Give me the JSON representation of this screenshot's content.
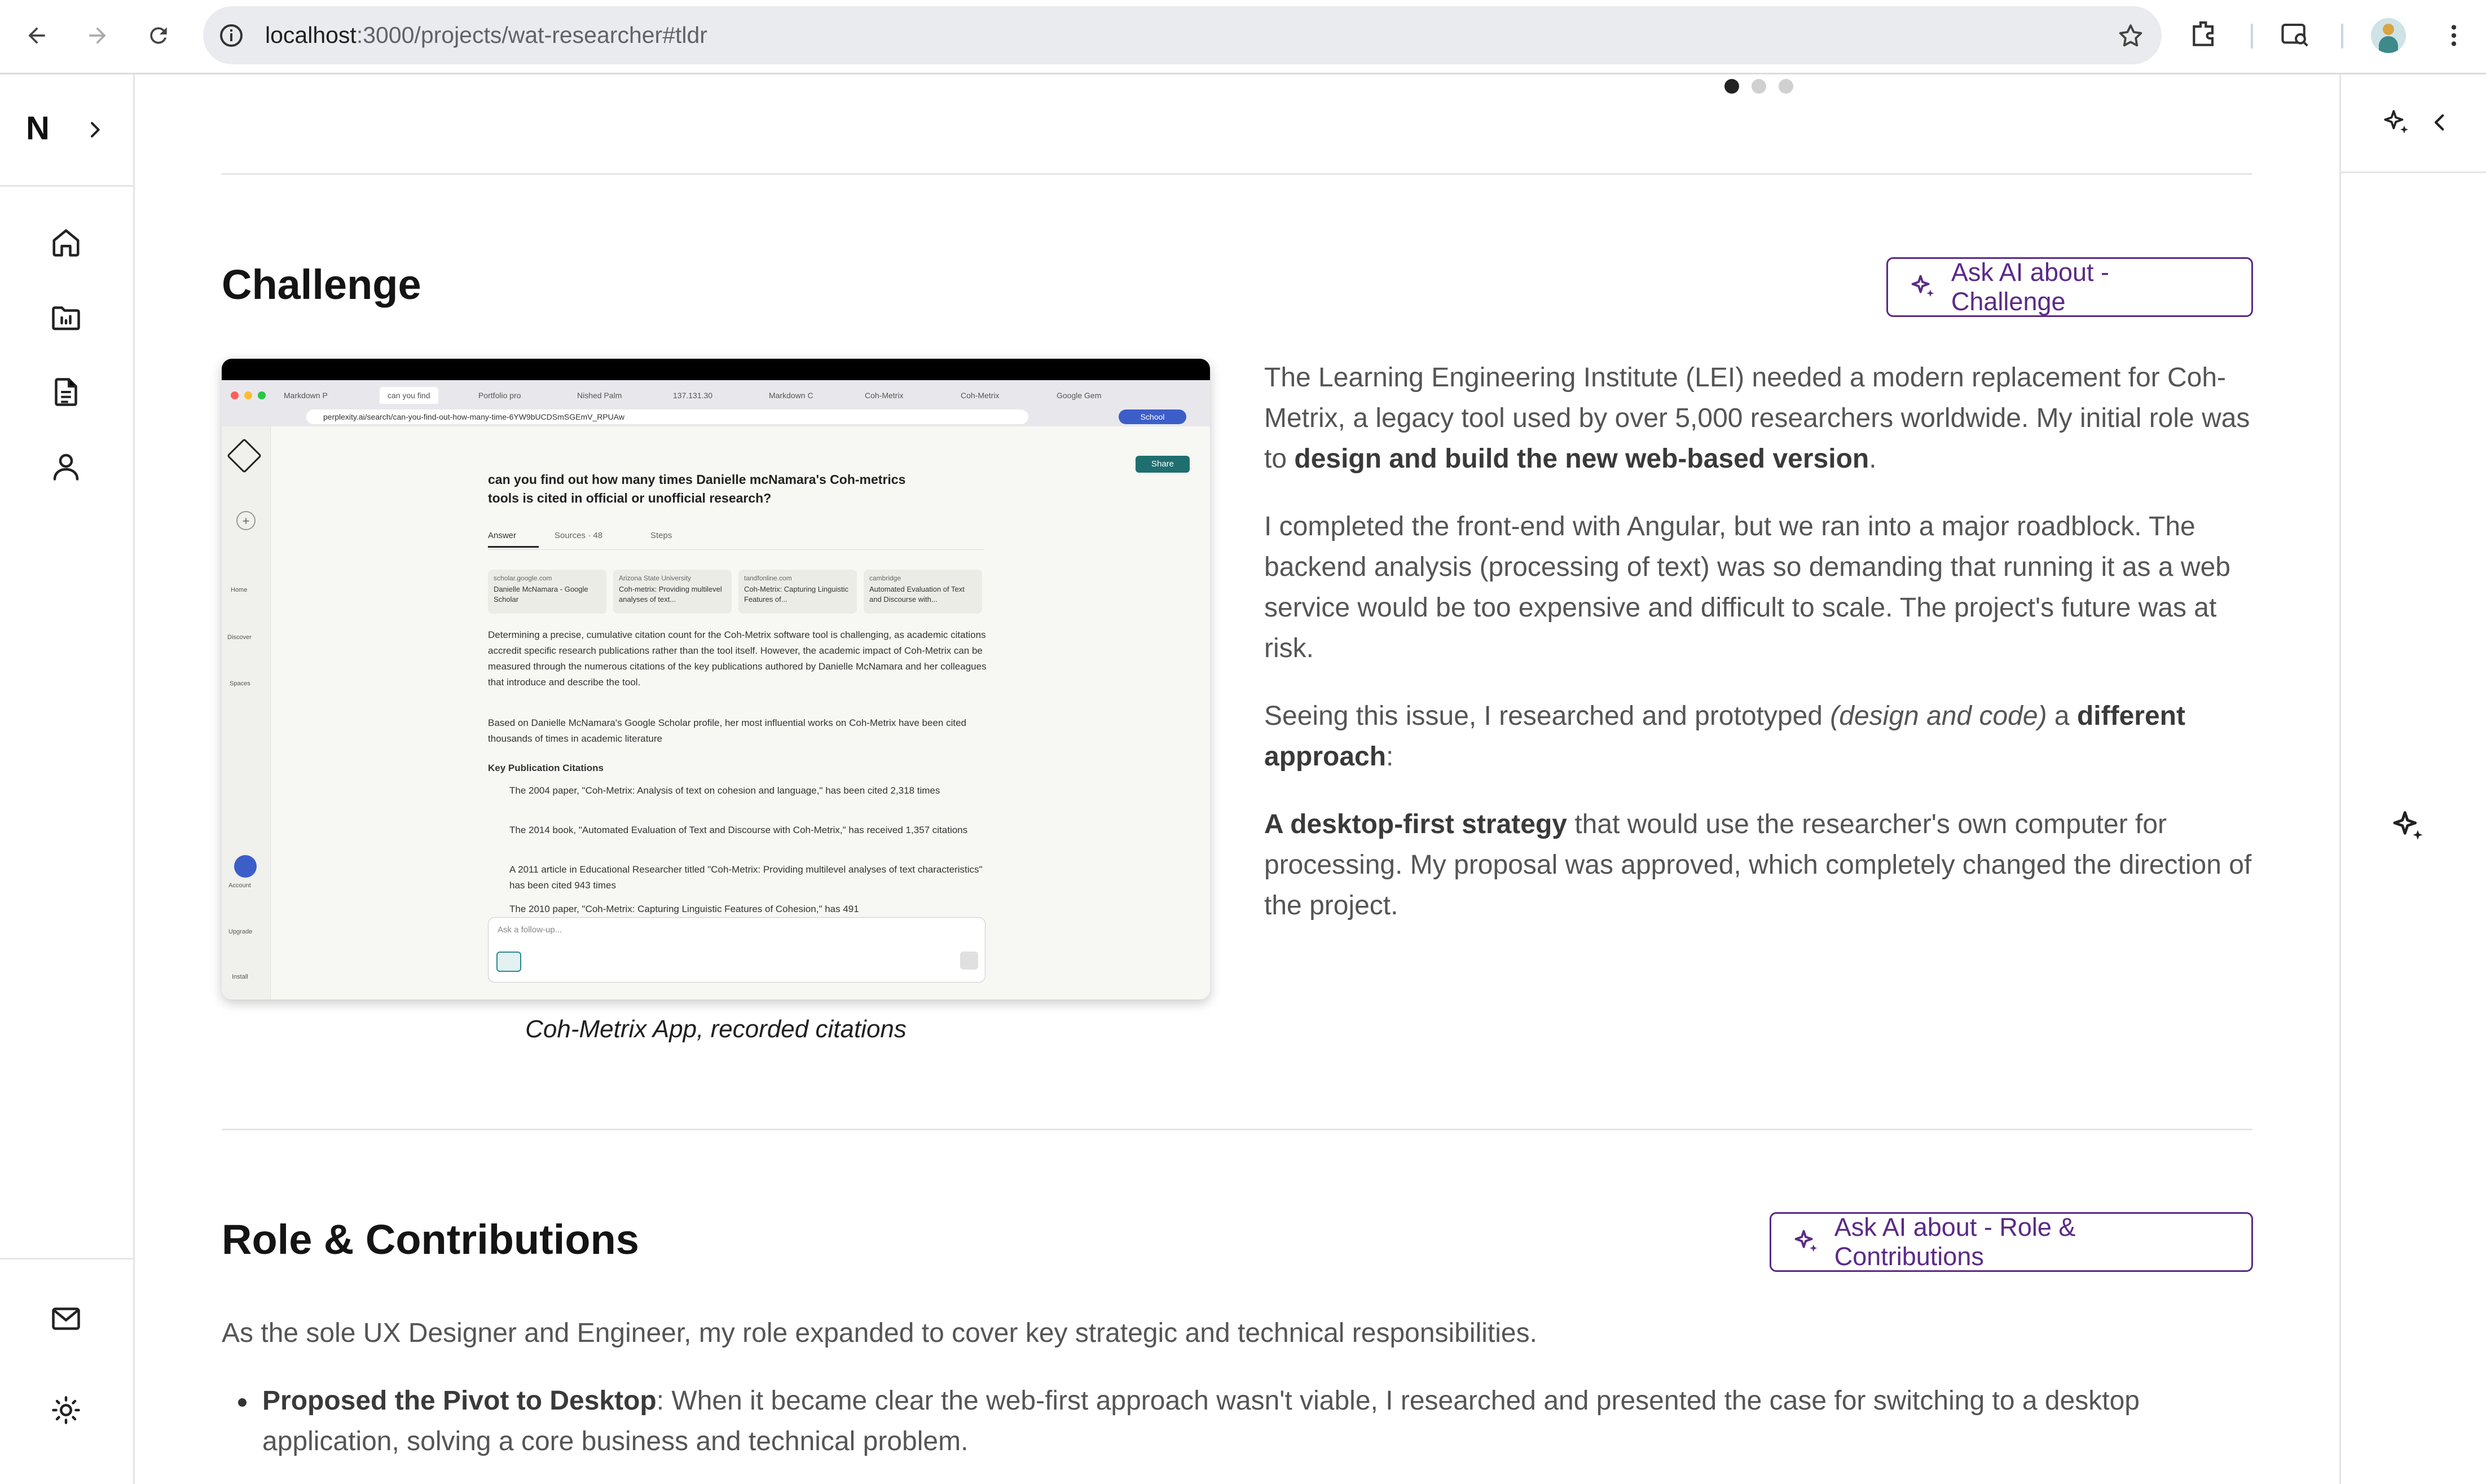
{
  "browser": {
    "url_host": "localhost",
    "url_path": ":3000/projects/wat-researcher#tldr",
    "back_icon": "arrow-left-icon",
    "forward_icon": "arrow-right-icon",
    "reload_icon": "reload-icon"
  },
  "sidebar": {
    "logo": "N",
    "expand_icon": "chevron-right-icon",
    "items": [
      {
        "icon": "home-icon",
        "label": "Home"
      },
      {
        "icon": "projects-icon",
        "label": "Projects"
      },
      {
        "icon": "document-icon",
        "label": "Resume"
      },
      {
        "icon": "user-icon",
        "label": "About"
      }
    ],
    "bottom": [
      {
        "icon": "mail-icon"
      },
      {
        "icon": "sun-icon"
      }
    ]
  },
  "carousel": {
    "dots": 3,
    "active": 0
  },
  "challenge": {
    "title": "Challenge",
    "ask_ai_label": "Ask AI about - Challenge",
    "image_caption": "Coh-Metrix App, recorded citations",
    "paragraphs": {
      "p1a": "The Learning Engineering Institute (LEI) needed a modern replacement for Coh-Metrix, a legacy tool used by over 5,000 researchers worldwide. My initial role was to ",
      "p1b": "design and build the new web-based version",
      "p1c": ".",
      "p2": "I completed the front-end with Angular, but we ran into a major roadblock. The backend analysis (processing of text) was so demanding that running it as a web service would be too expensive and difficult to scale. The project's future was at risk.",
      "p3a": "Seeing this issue, I researched and prototyped ",
      "p3b": "(design and code)",
      "p3c": " a ",
      "p3d": "different approach",
      "p3e": ":",
      "p4a": "A desktop-first strategy",
      "p4b": " that would use the researcher's own computer for processing. My proposal was approved, which completely changed the direction of the project."
    }
  },
  "embedded": {
    "tabs": [
      "Markdown P",
      "can you find",
      "Portfolio pro",
      "Nished Palm",
      "137.131.30",
      "Markdown C",
      "Coh-Metrix",
      "Coh-Metrix",
      "Google Gem"
    ],
    "url": "perplexity.ai/search/can-you-find-out-how-many-time-6YW9bUCDSmSGEmV_RPUAw",
    "school": "School",
    "question": "can you find out how many times Danielle mcNamara's Coh-metrics tools is cited in official or unofficial research?",
    "share": "Share",
    "answer_tab": "Answer",
    "sources_tab": "Sources · 48",
    "steps_tab": "Steps",
    "sources": [
      {
        "site": "scholar.google.com",
        "title": "Danielle McNamara - Google Scholar"
      },
      {
        "site": "Arizona State University",
        "title": "Coh-metrix: Providing multilevel analyses of text..."
      },
      {
        "site": "tandfonline.com",
        "title": "Coh-Metrix: Capturing Linguistic Features of..."
      },
      {
        "site": "cambridge",
        "title": "Automated Evaluation of Text and Discourse with..."
      }
    ],
    "answer_p1": "Determining a precise, cumulative citation count for the Coh-Metrix software tool is challenging, as academic citations accredit specific research publications rather than the tool itself. However, the academic impact of Coh-Metrix can be measured through the numerous citations of the key publications authored by Danielle McNamara and her colleagues that introduce and describe the tool.",
    "answer_p2": "Based on Danielle McNamara's Google Scholar profile, her most influential works on Coh-Metrix have been cited thousands of times in academic literature",
    "key_heading": "Key Publication Citations",
    "bullets": [
      "The 2004 paper, \"Coh-Metrix: Analysis of text on cohesion and language,\" has been cited 2,318 times",
      "The 2014 book, \"Automated Evaluation of Text and Discourse with Coh-Metrix,\" has received 1,357 citations",
      "A 2011 article in Educational Researcher titled \"Coh-Metrix: Providing multilevel analyses of text characteristics\" has been cited 943 times",
      "The 2010 paper, \"Coh-Metrix: Capturing Linguistic Features of Cohesion,\" has 491"
    ],
    "followup_placeholder": "Ask a follow-up...",
    "left_nav": [
      "Home",
      "Discover",
      "Spaces",
      "Account",
      "Upgrade",
      "Install"
    ]
  },
  "role": {
    "title": "Role & Contributions",
    "ask_ai_label": "Ask AI about - Role & Contributions",
    "intro": "As the sole UX Designer and Engineer, my role expanded to cover key strategic and technical responsibilities.",
    "bullet1_bold": "Proposed the Pivot to Desktop",
    "bullet1_text": ": When it became clear the web-first approach wasn't viable, I researched and presented the case for switching to a desktop application, solving a core business and technical problem."
  },
  "right_panel": {
    "sparkle_icon": "sparkle-icon",
    "collapse_icon": "chevron-left-icon"
  },
  "colors": {
    "accent": "#5b2a86",
    "text_body": "#555555",
    "heading": "#141414"
  }
}
